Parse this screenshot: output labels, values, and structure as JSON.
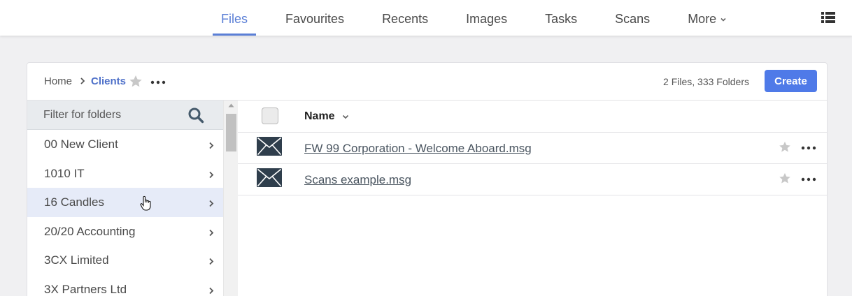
{
  "nav": {
    "items": [
      {
        "label": "Files",
        "active": true
      },
      {
        "label": "Favourites",
        "active": false
      },
      {
        "label": "Recents",
        "active": false
      },
      {
        "label": "Images",
        "active": false
      },
      {
        "label": "Tasks",
        "active": false
      },
      {
        "label": "Scans",
        "active": false
      },
      {
        "label": "More",
        "active": false
      }
    ],
    "view_icon": "list-view-icon"
  },
  "breadcrumb": {
    "home": "Home",
    "current": "Clients"
  },
  "summary": {
    "counts": "2 Files, 333 Folders"
  },
  "toolbar": {
    "create_label": "Create"
  },
  "folders": {
    "filter_placeholder": "Filter for folders",
    "items": [
      {
        "label": "00 New Client"
      },
      {
        "label": "1010 IT"
      },
      {
        "label": "16 Candles"
      },
      {
        "label": "20/20 Accounting"
      },
      {
        "label": "3CX Limited"
      },
      {
        "label": "3X Partners Ltd"
      }
    ]
  },
  "files": {
    "header_name": "Name",
    "items": [
      {
        "name": "FW 99 Corporation - Welcome Aboard.msg",
        "icon": "email-icon"
      },
      {
        "name": "Scans example.msg",
        "icon": "email-icon"
      }
    ]
  },
  "colors": {
    "accent": "#5b7fd6",
    "create_button": "#4f7ae8",
    "hover_row": "#e6ebf8"
  }
}
